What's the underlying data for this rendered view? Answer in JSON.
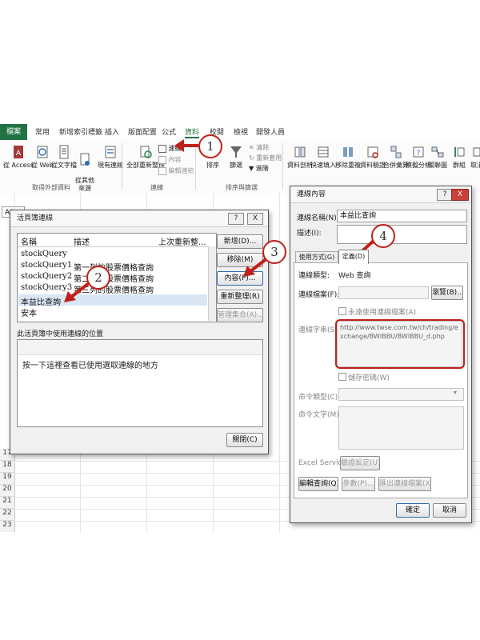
{
  "ribbon": {
    "tabs": [
      "檔案",
      "常用",
      "新增索引標籤",
      "插入",
      "版面配置",
      "公式",
      "資料",
      "校閱",
      "檢視",
      "開發人員"
    ],
    "active_tab": "資料",
    "buttons": {
      "from_access": "從 Access",
      "from_web": "從 Web",
      "from_text": "從文字檔",
      "from_other": "從其他\n來源",
      "existing_connections": "現有連線",
      "refresh_all": "全部重新整理",
      "connections": "連線",
      "properties": "內容",
      "edit_links": "編輯連結",
      "sort": "排序",
      "filter": "篩選",
      "clear": "清除",
      "reapply": "重新套用",
      "advanced": "進階",
      "text_to_columns": "資料剖析",
      "flash_fill": "快速填入",
      "remove_duplicates": "移除重複",
      "data_validation": "資料驗證",
      "consolidate": "合併彙算",
      "what_if": "模擬分析",
      "relationships": "關聯圖",
      "group": "群組",
      "ungroup": "取消"
    },
    "groups": {
      "get_external": "取得外部資料",
      "connections": "連線",
      "sort_filter": "排序與篩選"
    }
  },
  "sheet": {
    "name_box": "A1",
    "row_numbers": [
      "18",
      "19",
      "20",
      "21",
      "22",
      "23"
    ],
    "row_17_partial": "17"
  },
  "workbook_connections": {
    "title": "活頁簿連線",
    "help": "?",
    "close": "X",
    "columns": [
      "名稱",
      "描述",
      "上次重新整..."
    ],
    "rows": [
      {
        "name": "stockQuery",
        "desc": ""
      },
      {
        "name": "stockQuery1",
        "desc": "第一列的股票價格查詢"
      },
      {
        "name": "stockQuery2",
        "desc": "第二列的股票價格查詢"
      },
      {
        "name": "stockQuery3",
        "desc": "第三列的股票價格查詢"
      },
      {
        "name": "本益比查詢",
        "desc": ""
      },
      {
        "name": "安本",
        "desc": ""
      }
    ],
    "buttons": {
      "add": "新增(D)...",
      "remove": "移除(M)",
      "properties": "內容(P)...",
      "refresh": "重新整理(R)",
      "manage_sets": "管理集合(A)..."
    },
    "location_label": "此活頁簿中使用連線的位置",
    "location_hint": "按一下這裡查看已使用選取連線的地方",
    "close_button": "關閉(C)"
  },
  "connection_properties": {
    "title": "連線內容",
    "help": "?",
    "close": "X",
    "name_label": "連線名稱(N):",
    "name_value": "本益比查詢",
    "desc_label": "描述(I):",
    "tabs": [
      "使用方式(G)",
      "定義(D)"
    ],
    "active_tab": "定義(D)",
    "type_label": "連線類型:",
    "type_value": "Web 查詢",
    "file_label": "連線檔案(F):",
    "browse": "瀏覽(B)...",
    "always_use_file": "永遠使用連線檔案(A)",
    "string_label": "連線字串(S):",
    "string_value": "http://www.twse.com.tw/ch/trading/exchange/BWIBBU/BWIBBU_d.php",
    "save_password": "儲存密碼(W)",
    "command_type_label": "命令類型(C):",
    "command_text_label": "命令文字(M):",
    "excel_services": "Excel Services:",
    "auth_settings": "驗證設定(U)...",
    "edit_query": "編輯查詢(Q)...",
    "parameters": "參數(P)...",
    "export_file": "匯出連線檔案(X)...",
    "ok": "確定",
    "cancel": "取消"
  },
  "callouts": [
    "1",
    "2",
    "3",
    "4"
  ],
  "colors": {
    "accent": "#217346",
    "callout": "#c0201a"
  }
}
